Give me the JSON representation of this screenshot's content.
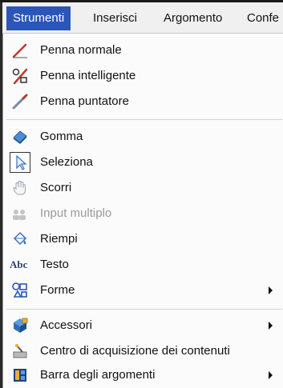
{
  "menubar": {
    "tabs": [
      "Strumenti",
      "Inserisci",
      "Argomento",
      "Confe"
    ]
  },
  "menu": {
    "items": [
      {
        "label": "Penna normale",
        "icon": "pen-icon"
      },
      {
        "label": "Penna intelligente",
        "icon": "smart-pen-icon"
      },
      {
        "label": "Penna puntatore",
        "icon": "pointer-pen-icon"
      },
      {
        "label": "Gomma",
        "icon": "eraser-icon"
      },
      {
        "label": "Seleziona",
        "icon": "select-arrow-icon"
      },
      {
        "label": "Scorri",
        "icon": "hand-scroll-icon"
      },
      {
        "label": "Input multiplo",
        "icon": "multiple-input-icon"
      },
      {
        "label": "Riempi",
        "icon": "fill-bucket-icon"
      },
      {
        "label": "Testo",
        "icon": "text-abc-icon",
        "icon_text": "Abc"
      },
      {
        "label": "Forme",
        "icon": "shapes-icon"
      },
      {
        "label": "Accessori",
        "icon": "accessories-icon"
      },
      {
        "label": "Centro di acquisizione dei contenuti",
        "icon": "content-capture-icon"
      },
      {
        "label": "Barra degli argomenti",
        "icon": "topics-bar-icon"
      }
    ]
  },
  "colors": {
    "active_tab": "#2a56b8",
    "disabled_text": "#9a9a9a"
  }
}
